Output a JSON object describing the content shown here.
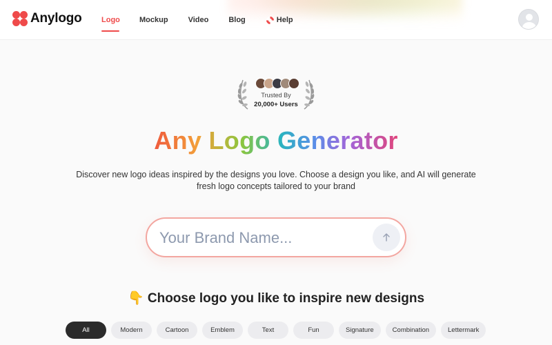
{
  "header": {
    "brand": "Anylogo",
    "nav": [
      {
        "label": "Logo",
        "active": true
      },
      {
        "label": "Mockup",
        "active": false
      },
      {
        "label": "Video",
        "active": false
      },
      {
        "label": "Blog",
        "active": false
      },
      {
        "label": "Help",
        "active": false,
        "icon": "lifebuoy-icon"
      }
    ],
    "accent_color": "#ef4a4a"
  },
  "trusted": {
    "label": "Trusted By",
    "count": "20,000+ Users"
  },
  "hero": {
    "title": "Any Logo Generator",
    "subtitle": "Discover new logo ideas inspired by the designs you love. Choose a design you like, and AI will generate fresh logo concepts tailored to your brand"
  },
  "search": {
    "placeholder": "Your Brand Name...",
    "value": ""
  },
  "section": {
    "title": "👇 Choose logo you like to inspire new designs"
  },
  "filters": [
    {
      "label": "All",
      "active": true
    },
    {
      "label": "Modern",
      "active": false
    },
    {
      "label": "Cartoon",
      "active": false
    },
    {
      "label": "Emblem",
      "active": false
    },
    {
      "label": "Text",
      "active": false
    },
    {
      "label": "Fun",
      "active": false
    },
    {
      "label": "Signature",
      "active": false
    },
    {
      "label": "Combination",
      "active": false
    },
    {
      "label": "Lettermark",
      "active": false
    }
  ]
}
